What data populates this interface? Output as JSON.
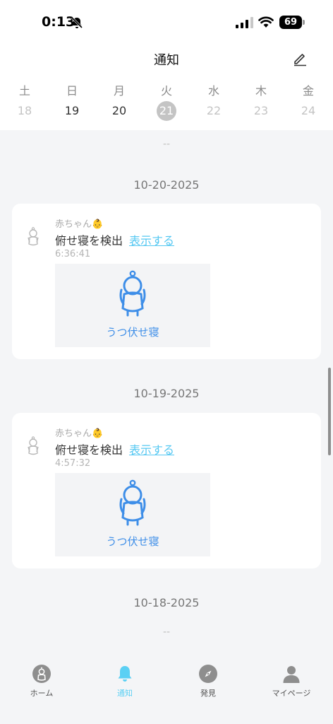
{
  "status_bar": {
    "time": "0:13",
    "battery": "69"
  },
  "header": {
    "title": "通知"
  },
  "calendar": {
    "weekdays": [
      "土",
      "日",
      "月",
      "火",
      "水",
      "木",
      "金"
    ],
    "days": [
      "18",
      "19",
      "20",
      "21",
      "22",
      "23",
      "24"
    ]
  },
  "feed": {
    "top_dash": "--",
    "bottom_dash": "--",
    "groups": [
      {
        "date": "10-20-2025",
        "card": {
          "sender": "赤ちゃん👶",
          "message": "俯せ寝を検出",
          "link": "表示する",
          "time": "6:36:41",
          "thumb_label": "うつ伏せ寝"
        }
      },
      {
        "date": "10-19-2025",
        "card": {
          "sender": "赤ちゃん👶",
          "message": "俯せ寝を検出",
          "link": "表示する",
          "time": "4:57:32",
          "thumb_label": "うつ伏せ寝"
        }
      },
      {
        "date": "10-18-2025"
      }
    ]
  },
  "tabbar": {
    "items": [
      {
        "label": "ホーム",
        "icon": "home-baby-icon"
      },
      {
        "label": "通知",
        "icon": "bell-icon"
      },
      {
        "label": "発見",
        "icon": "compass-icon"
      },
      {
        "label": "マイページ",
        "icon": "person-icon"
      }
    ],
    "active_index": 1
  },
  "colors": {
    "accent": "#5bd0f4",
    "link": "#56c8f2",
    "thumb_blue": "#3e8ee8",
    "today_dot": "#c4c4c4"
  }
}
